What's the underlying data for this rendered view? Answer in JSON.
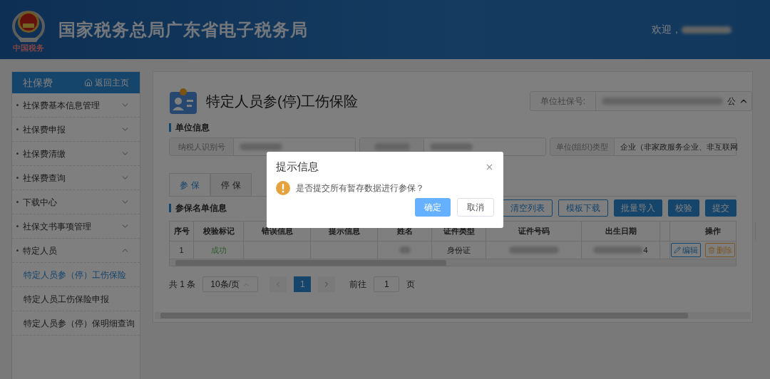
{
  "header": {
    "title": "国家税务总局广东省电子税务局",
    "logo_caption": "中国税务",
    "welcome": "欢迎，"
  },
  "sidebar": {
    "title": "社保费",
    "home_link": "返回主页",
    "items": [
      {
        "label": "社保费基本信息管理",
        "expanded": false
      },
      {
        "label": "社保费申报",
        "expanded": false
      },
      {
        "label": "社保费清缴",
        "expanded": false
      },
      {
        "label": "社保费查询",
        "expanded": false
      },
      {
        "label": "下载中心",
        "expanded": false
      },
      {
        "label": "社保文书事项管理",
        "expanded": false
      },
      {
        "label": "特定人员",
        "expanded": true,
        "children": [
          {
            "label": "特定人员参（停）工伤保险",
            "selected": true
          },
          {
            "label": "特定人员工伤保险申报",
            "selected": false
          },
          {
            "label": "特定人员参（停）保明细查询",
            "selected": false
          }
        ]
      }
    ]
  },
  "page": {
    "title": "特定人员参(停)工伤保险",
    "social_no_label": "单位社保号:",
    "social_no_tail": "公"
  },
  "unit_info": {
    "heading": "单位信息",
    "fields": [
      {
        "label": "纳税人识别号",
        "kind": "labeled"
      },
      {
        "kind": "redacted"
      },
      {
        "kind": "labeled",
        "label": "单位(组织)类型",
        "value": "企业（非家政服务企业、非互联网"
      }
    ]
  },
  "tabs": [
    {
      "label": "参 保",
      "selected": true
    },
    {
      "label": "停 保",
      "selected": false
    }
  ],
  "list": {
    "heading": "参保名单信息",
    "buttons": [
      {
        "label": "清空列表",
        "kind": "outline"
      },
      {
        "label": "模板下载",
        "kind": "outline"
      },
      {
        "label": "批量导入",
        "kind": "solid"
      },
      {
        "label": "校验",
        "kind": "solid"
      },
      {
        "label": "提交",
        "kind": "solid"
      }
    ]
  },
  "table": {
    "columns": [
      "序号",
      "校验标记",
      "错误信息",
      "提示信息",
      "姓名",
      "证件类型",
      "证件号码",
      "出生日期",
      "",
      "操作"
    ],
    "rows": [
      {
        "cells": [
          "1",
          "成功",
          "",
          "",
          "",
          "身份证",
          "",
          "4",
          ""
        ],
        "actions": [
          "编辑",
          "删除"
        ]
      }
    ]
  },
  "pagination": {
    "total": "共 1 条",
    "page_size": "10条/页",
    "pages": [
      {
        "label": "1",
        "selected": true
      }
    ],
    "goto_label": "前往",
    "goto_value": "1",
    "goto_suffix": "页"
  },
  "dialog": {
    "title": "提示信息",
    "message": "是否提交所有暂存数据进行参保？",
    "buttons": [
      {
        "label": "确定",
        "kind": "primary"
      },
      {
        "label": "取消",
        "kind": "default"
      }
    ]
  }
}
